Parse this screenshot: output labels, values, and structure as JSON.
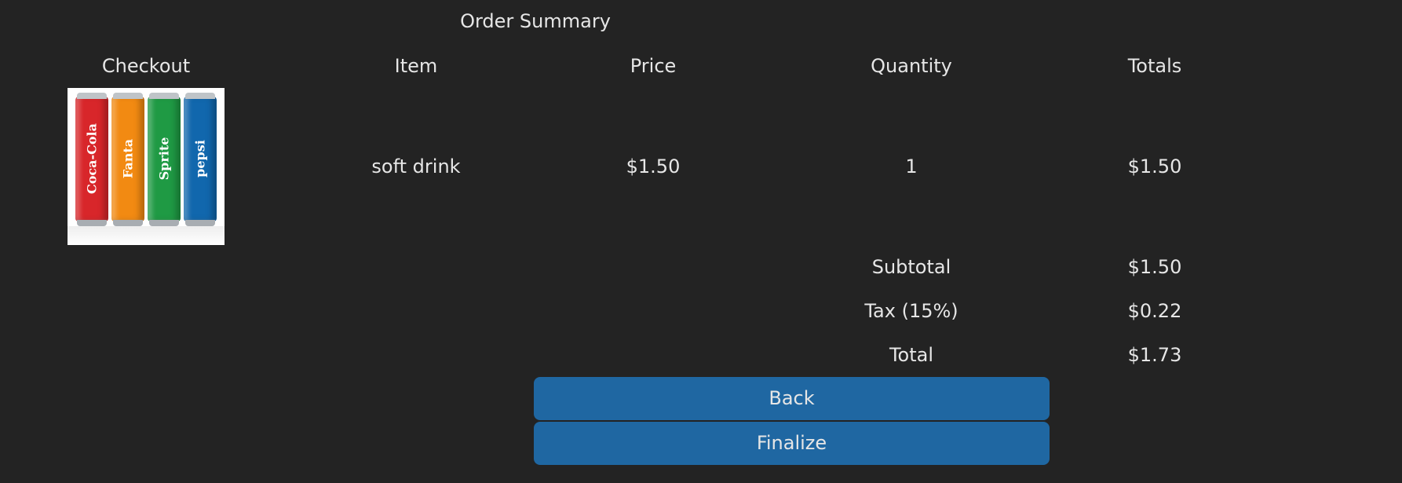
{
  "header": {
    "title": "Order Summary",
    "checkout_label": "Checkout"
  },
  "columns": {
    "item": "Item",
    "price": "Price",
    "quantity": "Quantity",
    "totals": "Totals"
  },
  "order": {
    "items": [
      {
        "name": "soft drink",
        "price": "$1.50",
        "quantity": "1",
        "total": "$1.50"
      }
    ]
  },
  "summary": {
    "subtotal_label": "Subtotal",
    "subtotal_value": "$1.50",
    "tax_label": "Tax (15%)",
    "tax_value": "$0.22",
    "total_label": "Total",
    "total_value": "$1.73"
  },
  "actions": {
    "back_label": "Back",
    "finalize_label": "Finalize"
  },
  "thumbnail": {
    "cans": [
      {
        "color": "#d8262a",
        "label": "Coca-Cola"
      },
      {
        "color": "#f28a12",
        "label": "Fanta"
      },
      {
        "color": "#1f9a44",
        "label": "Sprite"
      },
      {
        "color": "#1167ad",
        "label": "pepsi"
      }
    ]
  },
  "colors": {
    "background": "#232323",
    "text": "#e6e6e6",
    "button": "#1f67a2"
  }
}
